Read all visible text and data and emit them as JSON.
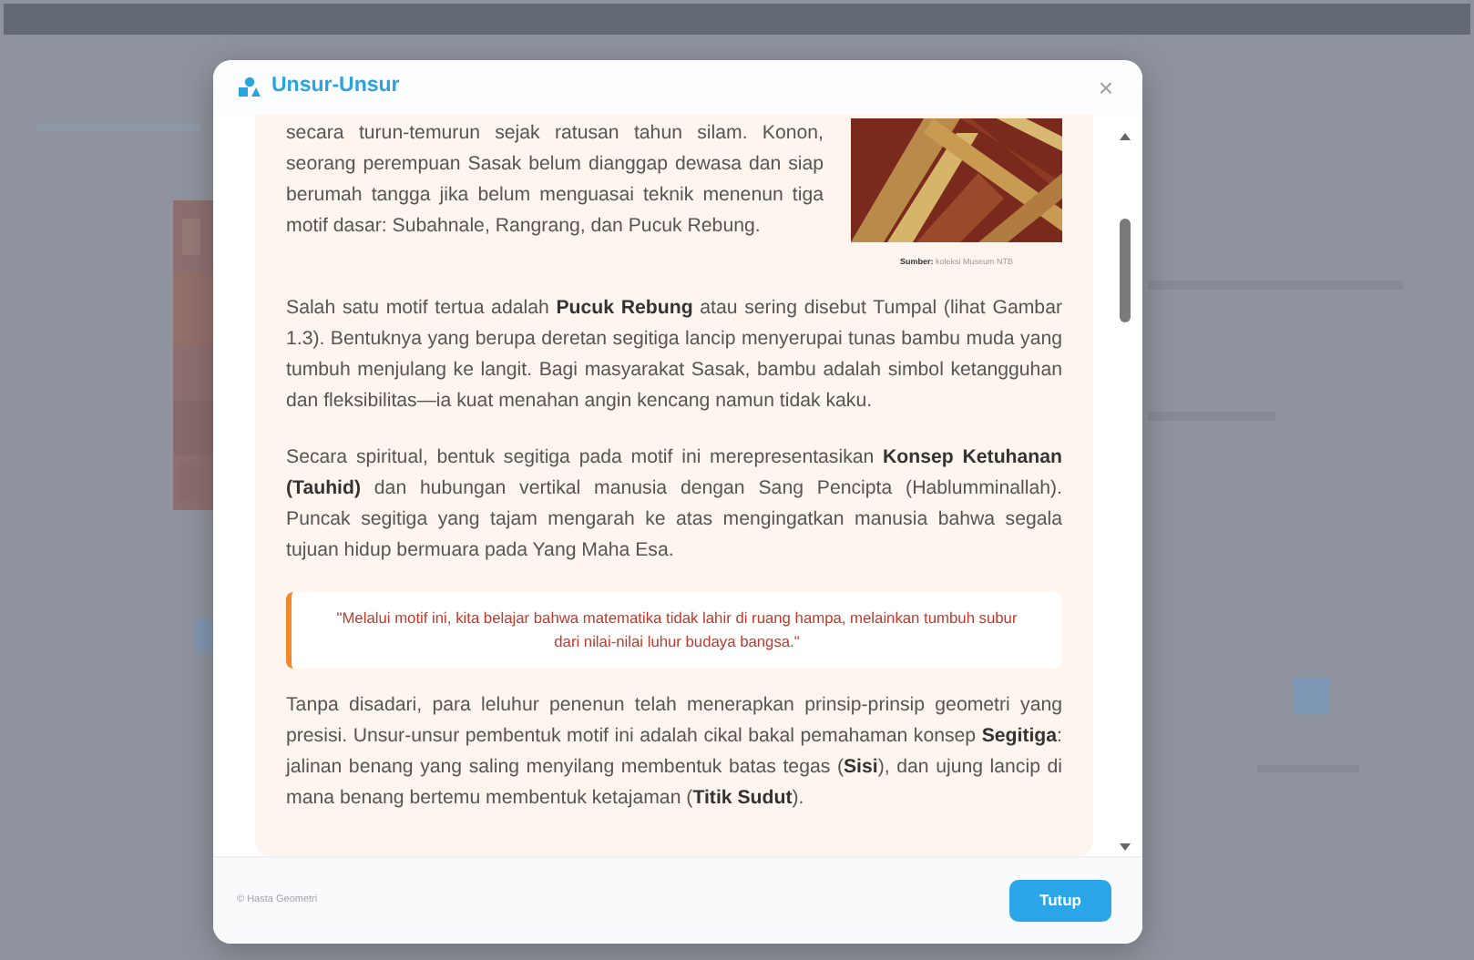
{
  "dialog": {
    "title": "Unsur-Unsur",
    "close_symbol": "×",
    "blocks": [
      {
        "kind": "text",
        "text": "secara turun-temurun sejak ratusan tahun silam. Konon, seorang perempuan Sasak belum dianggap dewasa dan siap berumah tangga jika belum menguasai teknik menenun tiga motif dasar: Subahnale, Rangrang, dan Pucuk Rebung.",
        "figure": {
          "kind": "picture",
          "caption": "**Sumber:** koleksi Museum NTB"
        }
      },
      {
        "kind": "text",
        "text": "Salah satu motif tertua adalah **Pucuk Rebung** atau sering disebut Tumpal (lihat Gambar 1.3). Bentuknya yang berupa deretan segitiga lancip menyerupai tunas bambu muda yang tumbuh menjulang ke langit. Bagi masyarakat Sasak, bambu adalah simbol ketangguhan dan fleksibilitas—ia kuat menahan angin kencang namun tidak kaku."
      },
      {
        "kind": "text",
        "text": "Secara spiritual, bentuk segitiga pada motif ini merepresentasikan **Konsep Ketuhanan (Tauhid)** dan hubungan vertikal manusia dengan Sang Pencipta (Hablumminallah). Puncak segitiga yang tajam mengarah ke atas mengingatkan manusia bahwa segala tujuan hidup bermuara pada Yang Maha Esa."
      },
      {
        "kind": "quote",
        "text": "\"Melalui motif ini, kita belajar bahwa matematika tidak lahir di ruang hampa, melainkan tumbuh subur dari nilai-nilai luhur budaya bangsa.\""
      },
      {
        "kind": "text",
        "text": "Tanpa disadari, para leluhur penenun telah menerapkan prinsip-prinsip geometri yang presisi. Unsur-unsur pembentuk motif ini adalah cikal bakal pemahaman konsep **Segitiga**: jalinan benang yang saling menyilang membentuk batas tegas (**Sisi**), dan ujung lancip di mana benang bertemu membentuk ketajaman (**Titik Sudut**)."
      }
    ],
    "footer": {
      "credit": "© Hasta Geometri",
      "button": "Tutup"
    }
  }
}
